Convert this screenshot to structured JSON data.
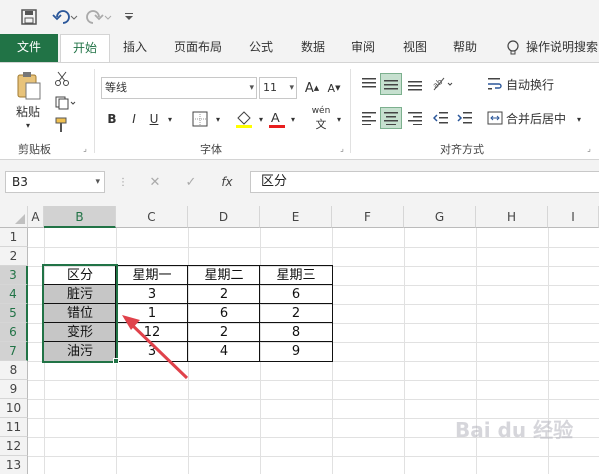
{
  "qat": {
    "save": "💾",
    "undo": "↶",
    "redo": "↷",
    "customize": "▾"
  },
  "tabs": [
    {
      "label": "文件"
    },
    {
      "label": "开始"
    },
    {
      "label": "插入"
    },
    {
      "label": "页面布局"
    },
    {
      "label": "公式"
    },
    {
      "label": "数据"
    },
    {
      "label": "审阅"
    },
    {
      "label": "视图"
    },
    {
      "label": "帮助"
    },
    {
      "label": "操作说明搜索"
    }
  ],
  "ribbon": {
    "clipboard": {
      "paste": "粘贴",
      "group": "剪贴板"
    },
    "font": {
      "name": "等线",
      "size": "11",
      "bold": "B",
      "italic": "I",
      "underline": "U",
      "group": "字体",
      "phonetic": "wén"
    },
    "alignment": {
      "wrap": "自动换行",
      "merge": "合并后居中",
      "group": "对齐方式"
    }
  },
  "formula_bar": {
    "name_box": "B3",
    "fx": "fx",
    "value": "区分"
  },
  "columns": [
    "A",
    "B",
    "C",
    "D",
    "E",
    "F",
    "G",
    "H",
    "I"
  ],
  "rows": [
    "1",
    "2",
    "3",
    "4",
    "5",
    "6",
    "7",
    "8",
    "9",
    "10",
    "11",
    "12",
    "13"
  ],
  "table": {
    "headers": [
      "区分",
      "星期一",
      "星期二",
      "星期三"
    ],
    "rows": [
      [
        "脏污",
        "3",
        "2",
        "6"
      ],
      [
        "错位",
        "1",
        "6",
        "2"
      ],
      [
        "变形",
        "12",
        "2",
        "8"
      ],
      [
        "油污",
        "3",
        "4",
        "9"
      ]
    ]
  },
  "watermark": "Bai du 经验",
  "colors": {
    "accent": "#217346",
    "shade": "#c6c6c6",
    "arrow": "#e0424b"
  }
}
